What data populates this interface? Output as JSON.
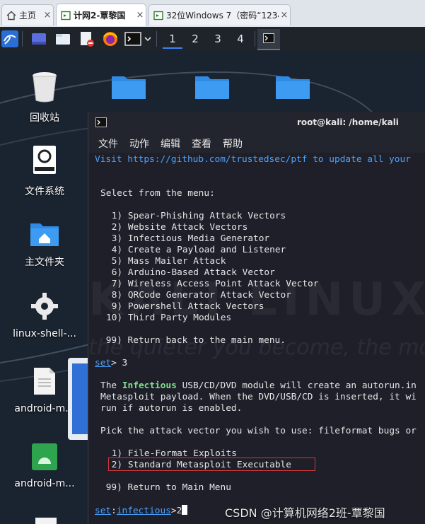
{
  "browser": {
    "tabs": [
      {
        "label": "主页",
        "close": "×"
      },
      {
        "label": "计网2-覃黎国",
        "close": "×"
      },
      {
        "label": "32位Windows 7（密码“1234...",
        "close": "×"
      }
    ]
  },
  "panel": {
    "workspaces": [
      "1",
      "2",
      "3",
      "4"
    ]
  },
  "desktop": {
    "icons": [
      {
        "label": "回收站"
      },
      {
        "label": "文件系统"
      },
      {
        "label": "主文件夹"
      },
      {
        "label": "linux-shell-..."
      },
      {
        "label": "android-m..."
      },
      {
        "label": "android-m..."
      }
    ]
  },
  "terminal": {
    "title": "root@kali: /home/kali",
    "menu": [
      "文件",
      "动作",
      "编辑",
      "查看",
      "帮助"
    ],
    "lines": {
      "visit_a": "Visit ",
      "visit_url": "https://github.com/trustedsec/ptf",
      "visit_b": " to update all your",
      "select": "Select from the menu:",
      "menu_items": [
        " 1) Spear-Phishing Attack Vectors",
        " 2) Website Attack Vectors",
        " 3) Infectious Media Generator",
        " 4) Create a Payload and Listener",
        " 5) Mass Mailer Attack",
        " 6) Arduino-Based Attack Vector",
        " 7) Wireless Access Point Attack Vector",
        " 8) QRCode Generator Attack Vector",
        " 9) Powershell Attack Vectors",
        "10) Third Party Modules"
      ],
      "return_main": " 99) Return back to the main menu.",
      "prompt1_set": "set",
      "prompt1_rest": "> 3",
      "desc1_a": "The ",
      "desc1_hl": "Infectious",
      "desc1_b": " USB/CD/DVD module will create an autorun.in",
      "desc2": "Metasploit payload. When the DVD/USB/CD is inserted, it wi",
      "desc3": "run if autorun is enabled.",
      "pick": "Pick the attack vector you wish to use: fileformat bugs or",
      "opt1": " 1) File-Format Exploits",
      "opt2": " 2) Standard Metasploit Executable",
      "opt99": " 99) Return to Main Menu",
      "prompt2_set": "set",
      "prompt2_colon": ":",
      "prompt2_mod": "infectious",
      "prompt2_rest": ">2"
    }
  },
  "watermark": "CSDN @计算机网络2班-覃黎国",
  "colors": {
    "link": "#4aa3ff",
    "highlight_green": "#7fe18a",
    "selection_box": "#d43a3a"
  }
}
